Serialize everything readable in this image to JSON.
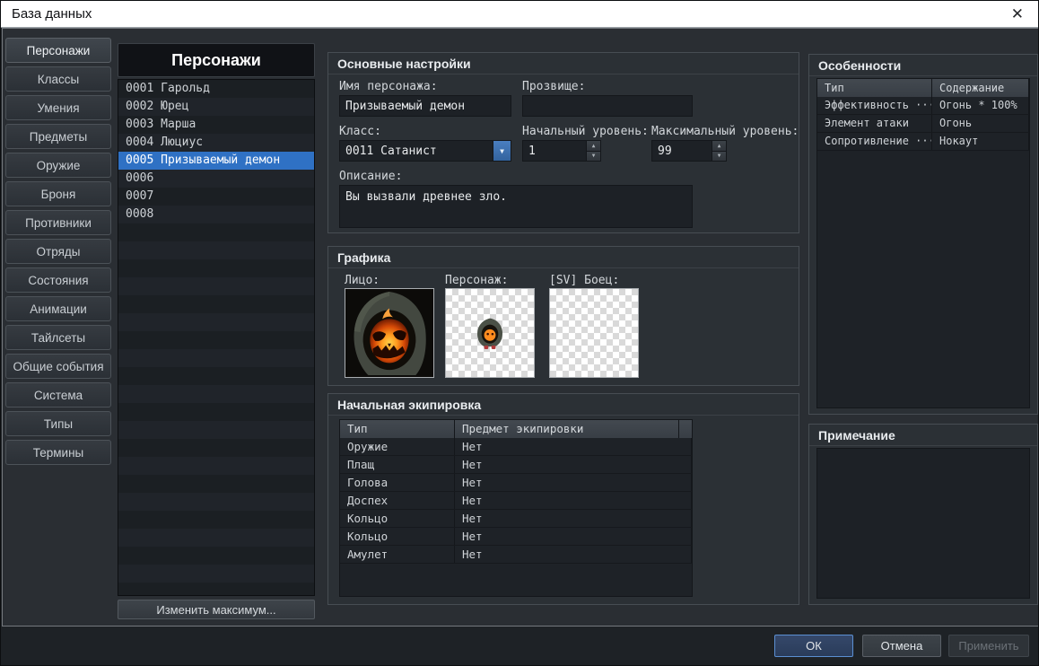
{
  "window": {
    "title": "База данных"
  },
  "icons": {
    "close": "✕",
    "dropdown_arrow": "▼",
    "spinner_up": "▲",
    "spinner_down": "▼"
  },
  "sidebar": {
    "tabs": [
      {
        "label": "Персонажи",
        "active": true
      },
      {
        "label": "Классы",
        "active": false
      },
      {
        "label": "Умения",
        "active": false
      },
      {
        "label": "Предметы",
        "active": false
      },
      {
        "label": "Оружие",
        "active": false
      },
      {
        "label": "Броня",
        "active": false
      },
      {
        "label": "Противники",
        "active": false
      },
      {
        "label": "Отряды",
        "active": false
      },
      {
        "label": "Состояния",
        "active": false
      },
      {
        "label": "Анимации",
        "active": false
      },
      {
        "label": "Тайлсеты",
        "active": false
      },
      {
        "label": "Общие события",
        "active": false
      },
      {
        "label": "Система",
        "active": false
      },
      {
        "label": "Типы",
        "active": false
      },
      {
        "label": "Термины",
        "active": false
      }
    ]
  },
  "list": {
    "title": "Персонажи",
    "items": [
      "0001 Гарольд",
      "0002 Юрец",
      "0003 Марша",
      "0004 Люциус",
      "0005 Призываемый демон",
      "0006",
      "0007",
      "0008"
    ],
    "selected_index": 4,
    "visible_rows": 28,
    "change_max_button": "Изменить максимум..."
  },
  "basic": {
    "title": "Основные настройки",
    "name_label": "Имя персонажа:",
    "name_value": "Призываемый демон",
    "nickname_label": "Прозвище:",
    "nickname_value": "",
    "class_label": "Класс:",
    "class_value": "0011 Сатанист",
    "initial_level_label": "Начальный уровень:",
    "initial_level_value": "1",
    "max_level_label": "Максимальный уровень:",
    "max_level_value": "99",
    "description_label": "Описание:",
    "description_value": "Вы вызвали древнее зло."
  },
  "graphics": {
    "title": "Графика",
    "face_label": "Лицо:",
    "character_label": "Персонаж:",
    "sv_label": "[SV] Боец:"
  },
  "equipment": {
    "title": "Начальная экипировка",
    "columns": [
      "Тип",
      "Предмет экипировки"
    ],
    "rows": [
      [
        "Оружие",
        "Нет"
      ],
      [
        "Плащ",
        "Нет"
      ],
      [
        "Голова",
        "Нет"
      ],
      [
        "Доспех",
        "Нет"
      ],
      [
        "Кольцо",
        "Нет"
      ],
      [
        "Кольцо",
        "Нет"
      ],
      [
        "Амулет",
        "Нет"
      ]
    ]
  },
  "traits": {
    "title": "Особенности",
    "columns": [
      "Тип",
      "Содержание"
    ],
    "rows": [
      [
        "Эффективность ···",
        "Огонь * 100%"
      ],
      [
        "Элемент атаки",
        "Огонь"
      ],
      [
        "Сопротивление ···",
        "Нокаут"
      ]
    ]
  },
  "note": {
    "title": "Примечание",
    "value": ""
  },
  "footer": {
    "ok": "ОК",
    "cancel": "Отмена",
    "apply": "Применить"
  }
}
